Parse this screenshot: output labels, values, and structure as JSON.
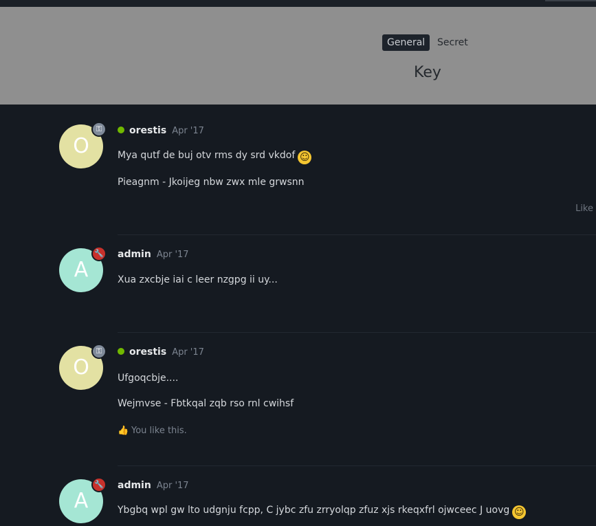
{
  "tabs": [
    {
      "label": "General",
      "active": true
    },
    {
      "label": "Secret",
      "active": false
    }
  ],
  "overlay": {
    "title": "Key"
  },
  "posts": [
    {
      "avatar_letter": "O",
      "username": "orestis",
      "date": "Apr '17",
      "online": true,
      "badge": "key-icon",
      "lines": [
        "Mya qutf de buj otv rms dy srd vkdof",
        "Pieagnm - Jkoijeg nbw zwx mle grwsnn"
      ],
      "action": "Like"
    },
    {
      "avatar_letter": "A",
      "username": "admin",
      "date": "Apr '17",
      "online": false,
      "badge": "wrench-icon",
      "lines": [
        "Xua zxcbje iai c leer nzgpg ii uy..."
      ]
    },
    {
      "avatar_letter": "O",
      "username": "orestis",
      "date": "Apr '17",
      "online": true,
      "badge": "key-icon",
      "lines": [
        "Ufgoqcbje....",
        "Wejmvse - Fbtkqal zqb rso rnl cwihsf"
      ],
      "liked_text": "You like this."
    },
    {
      "avatar_letter": "A",
      "username": "admin",
      "date": "Apr '17",
      "online": false,
      "badge": "wrench-icon",
      "lines": [
        "Ybgbq wpl gw lto udgnju fcpp, C jybc zfu zrryolqp zfuz xjs rkeqxfrl ojwceec J uovg"
      ]
    }
  ],
  "colors": {
    "online": "#71b800",
    "avatar_o": "#e3e1a3",
    "avatar_a": "#a5e6d4",
    "badge_admin": "#c8312b",
    "badge_key": "#7f8a99"
  }
}
